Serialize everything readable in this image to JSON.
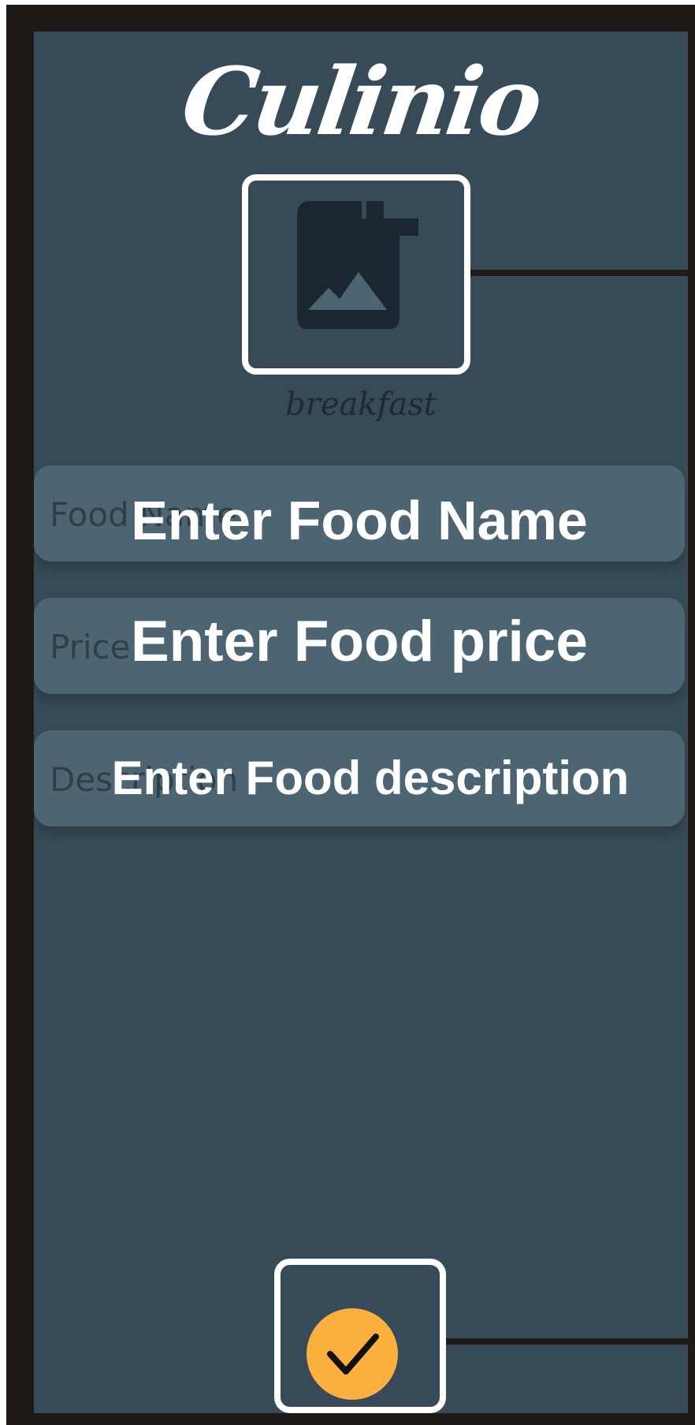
{
  "app": {
    "logo_text": "Culinio"
  },
  "image_picker": {
    "icon": "add-image-icon",
    "category": "breakfast"
  },
  "form": {
    "food_name": {
      "placeholder": "Food Name",
      "overlay_label": "Enter Food Name"
    },
    "price": {
      "placeholder": "Price",
      "overlay_label": "Enter Food price"
    },
    "description": {
      "placeholder": "Description",
      "overlay_label": "Enter Food description"
    }
  },
  "submit": {
    "icon": "check-icon",
    "color": "#fbb040"
  },
  "colors": {
    "background": "#364a57",
    "field": "#4d6572",
    "frame": "#201a17",
    "highlight": "#ffffff"
  }
}
